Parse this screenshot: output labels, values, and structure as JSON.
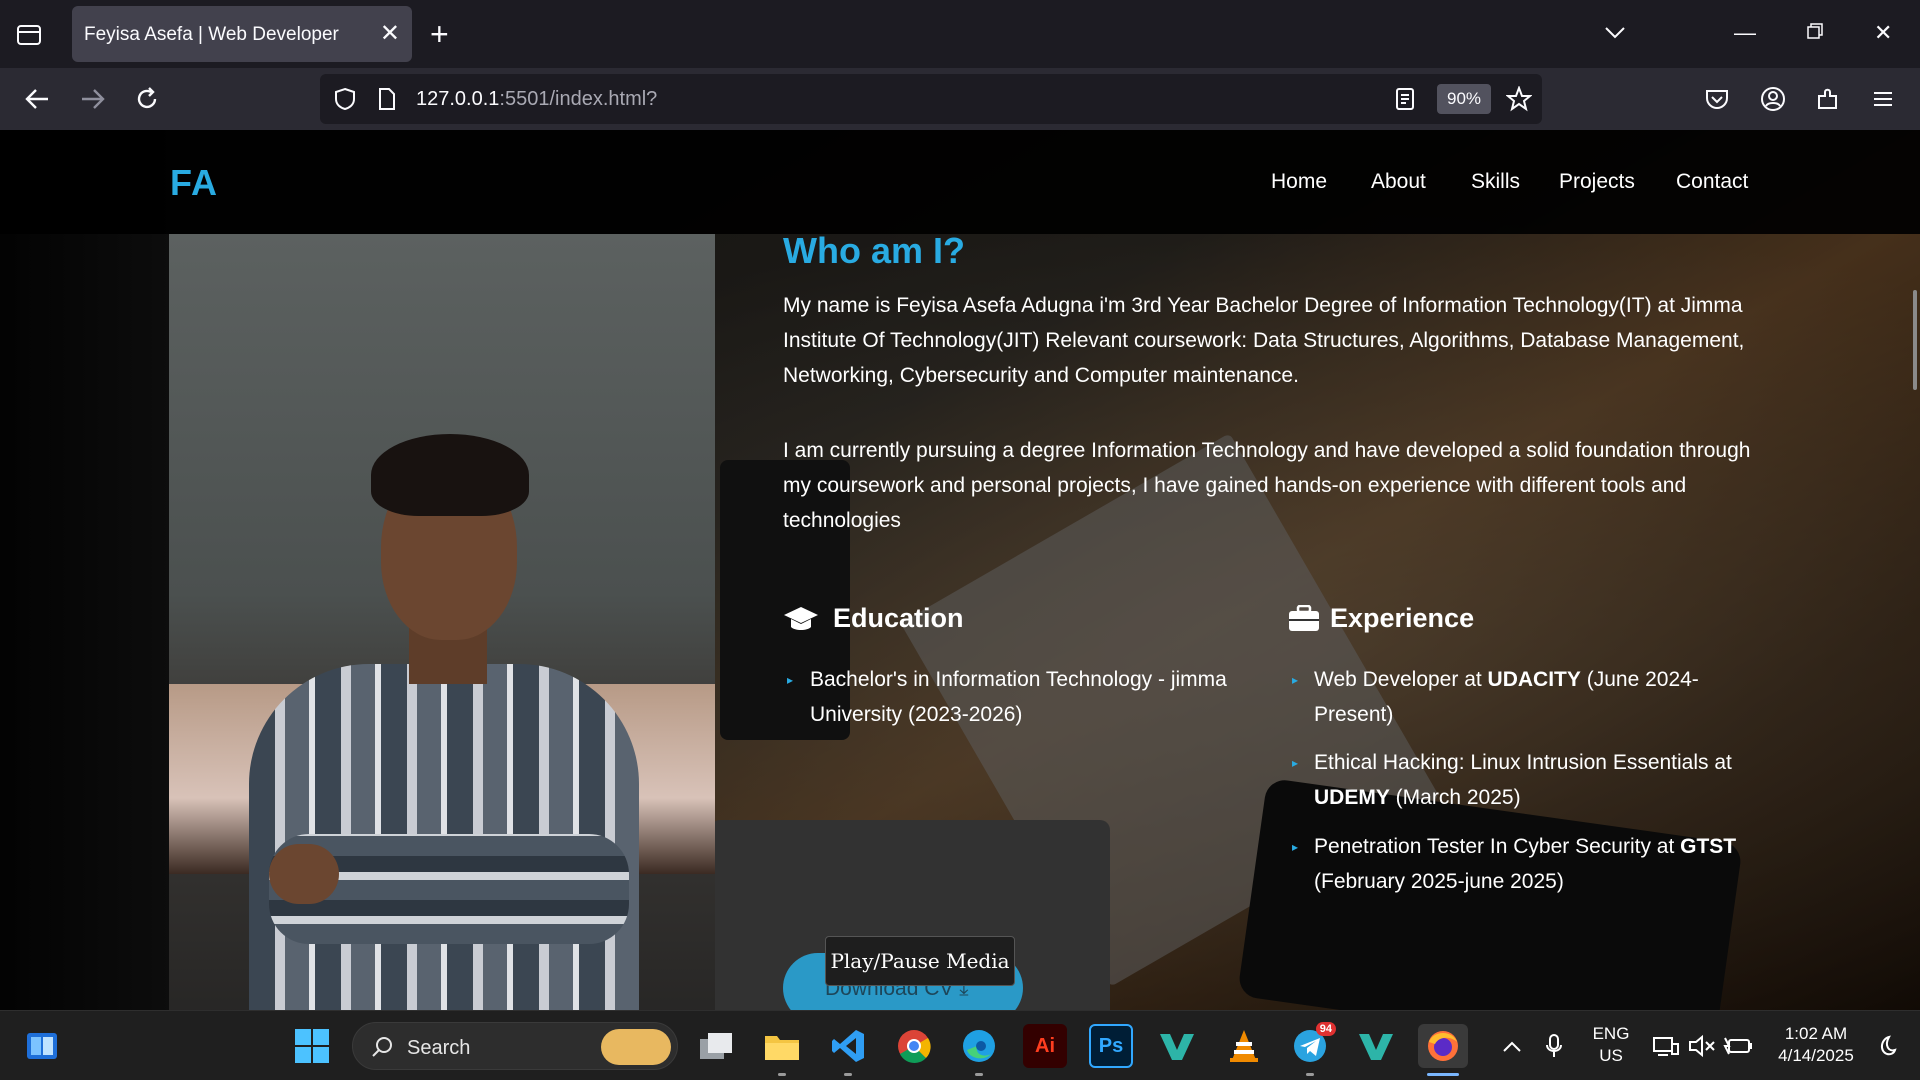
{
  "browser": {
    "tab_title": "Feyisa Asefa | Web Developer",
    "url_host": "127.0.0.1",
    "url_rest": ":5501/index.html?",
    "zoom": "90%"
  },
  "site": {
    "logo": "FA",
    "nav": [
      "Home",
      "About",
      "Skills",
      "Projects",
      "Contact"
    ],
    "about": {
      "title": "Who am I?",
      "para1": "My name is Feyisa Asefa Adugna i'm 3rd Year Bachelor Degree of Information Technology(IT) at Jimma Institute Of Technology(JIT) Relevant coursework: Data Structures, Algorithms, Database Management, Networking, Cybersecurity and Computer maintenance.",
      "para2": "I am currently pursuing a degree Information Technology and have developed a solid foundation through my coursework and personal projects, I have gained hands-on experience with different tools and technologies",
      "education": {
        "title": "Education",
        "items": [
          "Bachelor's in Information Technology - jimma University (2023-2026)"
        ]
      },
      "experience": {
        "title": "Experience",
        "items": [
          {
            "pre": "Web Developer at ",
            "org": "UDACITY",
            "post": " (June 2024-Present)"
          },
          {
            "pre": "Ethical Hacking: Linux Intrusion Essentials at ",
            "org": "UDEMY",
            "post": " (March 2025)"
          },
          {
            "pre": "Penetration Tester In Cyber Security at ",
            "org": "GTST",
            "post": " (February 2025-june 2025)"
          }
        ]
      },
      "download_label": "Download CV",
      "media_tooltip": "Play/Pause Media"
    }
  },
  "taskbar": {
    "search_label": "Search",
    "lang_line1": "ENG",
    "lang_line2": "US",
    "time": "1:02 AM",
    "date": "4/14/2025",
    "telegram_badge": "94",
    "ai_label": "Ai",
    "ps_label": "Ps"
  },
  "colors": {
    "accent": "#29abe2",
    "chrome_bg": "#1c1b22",
    "taskbar_bg": "#1f1f1f"
  }
}
